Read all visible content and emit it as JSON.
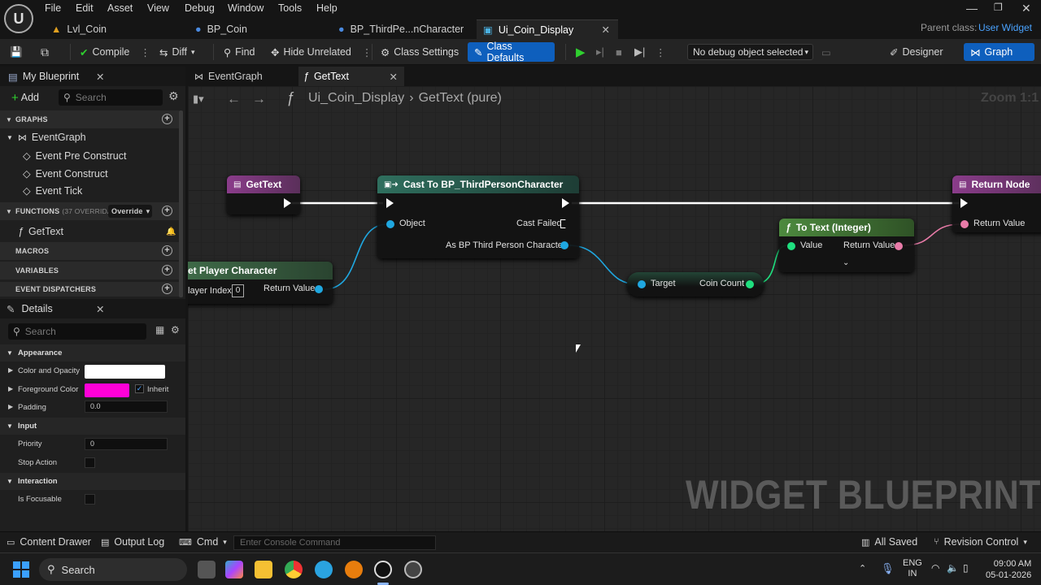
{
  "menu": [
    "File",
    "Edit",
    "Asset",
    "View",
    "Debug",
    "Window",
    "Tools",
    "Help"
  ],
  "tabs": [
    "Lvl_Coin",
    "BP_Coin",
    "BP_ThirdPe...nCharacter",
    "Ui_Coin_Display"
  ],
  "parent_class_label": "Parent class:",
  "parent_class_value": "User Widget",
  "toolbar": {
    "compile": "Compile",
    "diff": "Diff",
    "find": "Find",
    "hide_unrelated": "Hide Unrelated",
    "class_settings": "Class Settings",
    "class_defaults": "Class Defaults",
    "debug_object": "No debug object selected",
    "designer": "Designer",
    "graph": "Graph"
  },
  "my_blueprint": {
    "title": "My Blueprint",
    "add": "Add",
    "search_placeholder": "Search",
    "graphs_header": "GRAPHS",
    "event_graph": "EventGraph",
    "events": [
      "Event Pre Construct",
      "Event Construct",
      "Event Tick"
    ],
    "functions_header": "FUNCTIONS",
    "functions_count": "(37 OVERRIDAB",
    "override": "Override",
    "function_item": "GetText",
    "macros_header": "MACROS",
    "variables_header": "VARIABLES",
    "dispatchers_header": "EVENT DISPATCHERS"
  },
  "details": {
    "title": "Details",
    "search_placeholder": "Search",
    "appearance": "Appearance",
    "color_opacity": "Color and Opacity",
    "foreground_color": "Foreground Color",
    "inherit": "Inherit",
    "padding": "Padding",
    "padding_value": "0.0",
    "input": "Input",
    "priority": "Priority",
    "priority_value": "0",
    "stop_action": "Stop Action",
    "interaction": "Interaction",
    "is_focusable": "Is Focusable"
  },
  "graph_tabs": [
    "EventGraph",
    "GetText"
  ],
  "breadcrumb": {
    "widget": "Ui_Coin_Display",
    "function": "GetText (pure)"
  },
  "zoom": "Zoom 1:1",
  "nodes": {
    "gettext": "GetText",
    "cast": "Cast To BP_ThirdPersonCharacter",
    "cast_object": "Object",
    "cast_failed": "Cast Failed",
    "cast_as": "As BP Third Person Character",
    "get_player": "et Player Character",
    "player_index": "layer Index",
    "player_index_value": "0",
    "return_value": "Return Value",
    "target": "Target",
    "coin_count": "Coin Count",
    "to_text": "To Text (Integer)",
    "value": "Value",
    "return_node": "Return Node"
  },
  "watermark": "WIDGET BLUEPRINT",
  "statusbar": {
    "content_drawer": "Content Drawer",
    "output_log": "Output Log",
    "cmd": "Cmd",
    "console_placeholder": "Enter Console Command",
    "all_saved": "All Saved",
    "revision_control": "Revision Control"
  },
  "taskbar": {
    "search": "Search",
    "lang1": "ENG",
    "lang2": "IN",
    "time": "09:00 AM",
    "date": "05-01-2026"
  },
  "colors": {
    "accent": "#0e5fbd",
    "exec": "#ffffff",
    "object_pin": "#1fa7e0",
    "int_pin": "#1fe07f",
    "text_pin": "#e87ba8",
    "foreground": "#ff00d8"
  }
}
